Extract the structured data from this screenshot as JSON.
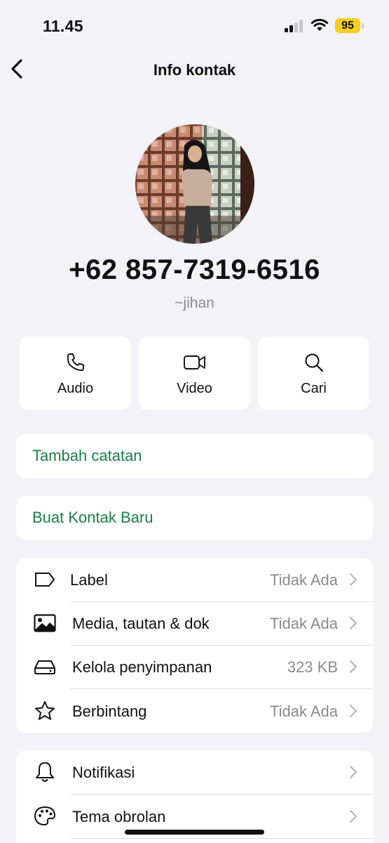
{
  "status_bar": {
    "time": "11.45",
    "battery": "95"
  },
  "nav": {
    "title": "Info kontak",
    "back_icon": "chevron-left-icon"
  },
  "contact": {
    "phone": "+62 857-7319-6516",
    "username": "~jihan"
  },
  "actions": [
    {
      "label": "Audio",
      "icon": "phone-icon"
    },
    {
      "label": "Video",
      "icon": "video-camera-icon"
    },
    {
      "label": "Cari",
      "icon": "search-icon"
    }
  ],
  "add_note": {
    "label": "Tambah catatan"
  },
  "new_contact": {
    "label": "Buat Kontak Baru"
  },
  "info_list": [
    {
      "icon": "tag-icon",
      "title": "Label",
      "value": "Tidak Ada"
    },
    {
      "icon": "image-icon",
      "title": "Media, tautan & dok",
      "value": "Tidak Ada"
    },
    {
      "icon": "storage-icon",
      "title": "Kelola penyimpanan",
      "value": "323 KB"
    },
    {
      "icon": "star-icon",
      "title": "Berbintang",
      "value": "Tidak Ada"
    }
  ],
  "settings_list": [
    {
      "icon": "bell-icon",
      "title": "Notifikasi",
      "value": ""
    },
    {
      "icon": "palette-icon",
      "title": "Tema obrolan",
      "value": ""
    }
  ],
  "colors": {
    "accent": "#1a7f4b",
    "background": "#f2f2f7",
    "battery": "#f7ce1b"
  }
}
